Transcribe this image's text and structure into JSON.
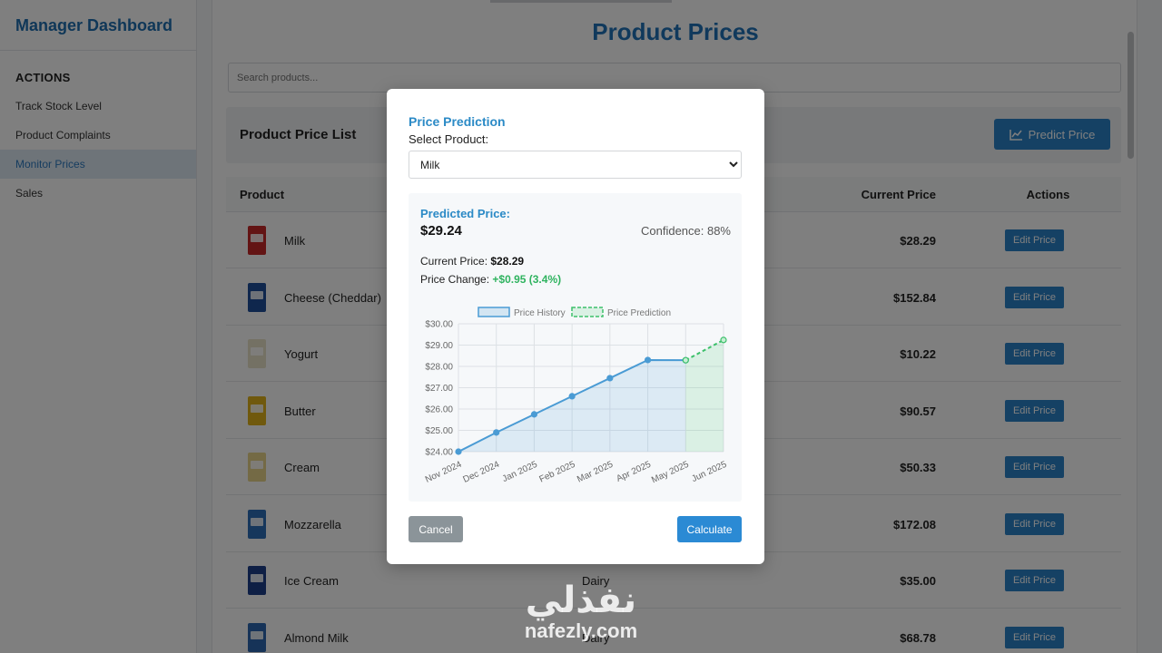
{
  "sidebar": {
    "title": "Manager Dashboard",
    "section": "ACTIONS",
    "items": [
      {
        "label": "Track Stock Level"
      },
      {
        "label": "Product Complaints"
      },
      {
        "label": "Monitor Prices"
      },
      {
        "label": "Sales"
      }
    ]
  },
  "page": {
    "title": "Product Prices",
    "search_placeholder": "Search products...",
    "list_title": "Product Price List",
    "predict_button": "Predict Price"
  },
  "table": {
    "columns": {
      "product": "Product",
      "current_price": "Current Price",
      "actions": "Actions"
    },
    "edit_label": "Edit Price",
    "rows": [
      {
        "name": "Milk",
        "category": "",
        "price": "$28.29",
        "icon": "milk-carton-icon",
        "color": "#c62828"
      },
      {
        "name": "Cheese (Cheddar)",
        "category": "",
        "price": "$152.84",
        "icon": "cheese-pack-icon",
        "color": "#1f4e9a"
      },
      {
        "name": "Yogurt",
        "category": "",
        "price": "$10.22",
        "icon": "yogurt-cup-icon",
        "color": "#e8e2c8"
      },
      {
        "name": "Butter",
        "category": "",
        "price": "$90.57",
        "icon": "butter-pack-icon",
        "color": "#e0b31a"
      },
      {
        "name": "Cream",
        "category": "",
        "price": "$50.33",
        "icon": "cream-carton-icon",
        "color": "#e8d48a"
      },
      {
        "name": "Mozzarella",
        "category": "",
        "price": "$172.08",
        "icon": "mozzarella-pack-icon",
        "color": "#2d6fb8"
      },
      {
        "name": "Ice Cream",
        "category": "Dairy",
        "price": "$35.00",
        "icon": "ice-cream-tub-icon",
        "color": "#1d3f8a"
      },
      {
        "name": "Almond Milk",
        "category": "Dairy",
        "price": "$68.78",
        "icon": "almond-milk-carton-icon",
        "color": "#2c67b0"
      }
    ]
  },
  "modal": {
    "title": "Price Prediction",
    "select_label": "Select Product:",
    "selected_product": "Milk",
    "predicted_label": "Predicted Price:",
    "predicted_value": "$29.24",
    "confidence": "Confidence: 88%",
    "current_label": "Current Price:",
    "current_value": "$28.29",
    "change_label": "Price Change:",
    "change_value": "+$0.95 (3.4%)",
    "cancel_button": "Cancel",
    "calculate_button": "Calculate"
  },
  "chart_data": {
    "type": "line",
    "categories": [
      "Nov 2024",
      "Dec 2024",
      "Jan 2025",
      "Feb 2025",
      "Mar 2025",
      "Apr 2025",
      "May 2025",
      "Jun 2025"
    ],
    "series": [
      {
        "name": "Price History",
        "values": [
          24.0,
          24.9,
          25.75,
          26.6,
          27.45,
          28.3,
          28.29,
          null
        ],
        "color": "#4a9bd4"
      },
      {
        "name": "Price Prediction",
        "values": [
          null,
          null,
          null,
          null,
          null,
          null,
          28.29,
          29.24
        ],
        "color": "#3cc06a",
        "dashed": true
      }
    ],
    "yticks": [
      "$30.00",
      "$29.00",
      "$28.00",
      "$27.00",
      "$26.00",
      "$25.00",
      "$24.00"
    ],
    "ylim": [
      24,
      30
    ],
    "grid": true,
    "legend": "top"
  },
  "watermark": {
    "arabic": "نفذلي",
    "latin": "nafezly.com"
  },
  "colors": {
    "accent": "#2b82c9",
    "title": "#2173b8",
    "positive": "#2fb35f"
  }
}
